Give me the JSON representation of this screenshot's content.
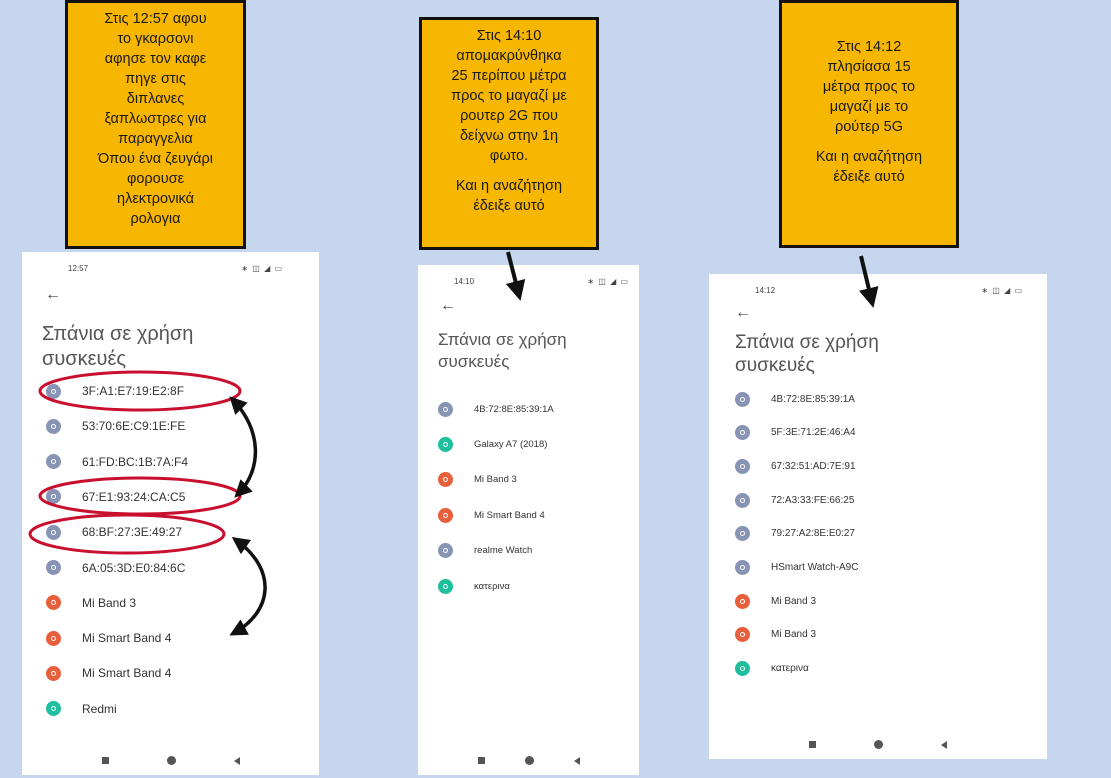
{
  "notes": [
    {
      "lines": [
        "Στις 12:57 αφου",
        "το γκαρσονι",
        "αφησε τον καφε",
        "πηγε στις",
        "διπλανες",
        "ξαπλωστρες για",
        "παραγγελια",
        "Όπου ένα ζευγάρι",
        "φορουσε",
        "ηλεκτρονικά",
        "ρολογια"
      ]
    },
    {
      "lines": [
        "Στις 14:10",
        "απομακρύνθηκα",
        "25 περίπου μέτρα",
        "προς το μαγαζί με",
        "ρουτερ 2G που",
        "δείχνω στην 1η",
        "φωτο.",
        "",
        "Και η αναζήτηση",
        "έδειξε αυτό"
      ]
    },
    {
      "lines": [
        "Στις 14:12",
        "πλησίασα 15",
        "μέτρα προς το",
        "μαγαζί με το",
        "ρούτερ 5G",
        "",
        "Και η αναζήτηση",
        "έδειξε αυτό"
      ]
    }
  ],
  "screens": [
    {
      "time": "12:57",
      "status_icons": "∗ ◫ ◢ ▭",
      "back": "←",
      "title_line1": "Σπάνια σε χρήση",
      "title_line2": "συσκευές",
      "devices": [
        {
          "name": "3F:A1:E7:19:E2:8F",
          "color": "gray"
        },
        {
          "name": "53:70:6E:C9:1E:FE",
          "color": "gray"
        },
        {
          "name": "61:FD:BC:1B:7A:F4",
          "color": "gray"
        },
        {
          "name": "67:E1:93:24:CA:C5",
          "color": "gray"
        },
        {
          "name": "68:BF:27:3E:49:27",
          "color": "gray"
        },
        {
          "name": "6A:05:3D:E0:84:6C",
          "color": "gray"
        },
        {
          "name": "Mi Band 3",
          "color": "orange"
        },
        {
          "name": "Mi Smart Band 4",
          "color": "orange"
        },
        {
          "name": "Mi Smart Band 4",
          "color": "orange"
        },
        {
          "name": "Redmi",
          "color": "teal"
        }
      ]
    },
    {
      "time": "14:10",
      "status_icons": "∗ ◫ ◢ ▭",
      "back": "←",
      "title_line1": "Σπάνια σε χρήση",
      "title_line2": "συσκευές",
      "devices": [
        {
          "name": "4B:72:8E:85:39:1A",
          "color": "gray"
        },
        {
          "name": "Galaxy A7 (2018)",
          "color": "teal"
        },
        {
          "name": "Mi Band 3",
          "color": "orange"
        },
        {
          "name": "Mi Smart Band 4",
          "color": "orange"
        },
        {
          "name": "realme Watch",
          "color": "gray"
        },
        {
          "name": "κατερινα",
          "color": "teal"
        }
      ]
    },
    {
      "time": "14:12",
      "status_icons": "∗ ◫ ◢ ▭",
      "back": "←",
      "title_line1": "Σπάνια σε χρήση",
      "title_line2": "συσκευές",
      "devices": [
        {
          "name": "4B:72:8E:85:39:1A",
          "color": "gray"
        },
        {
          "name": "5F:3E:71:2E:46:A4",
          "color": "gray"
        },
        {
          "name": "67:32:51:AD:7E:91",
          "color": "gray"
        },
        {
          "name": "72:A3:33:FE:66:25",
          "color": "gray"
        },
        {
          "name": "79:27:A2:8E:E0:27",
          "color": "gray"
        },
        {
          "name": "HSmart Watch-A9C",
          "color": "gray"
        },
        {
          "name": "Mi Band 3",
          "color": "orange"
        },
        {
          "name": "Mi Band 3",
          "color": "orange"
        },
        {
          "name": "κατερινα",
          "color": "teal"
        }
      ]
    }
  ],
  "colors": {
    "background": "#c5d6ee",
    "note": "#f7b600",
    "device_gray": "#8894b4",
    "device_orange": "#e85f3c",
    "device_teal": "#1fbf9e",
    "circle_annotation": "#c8102e"
  },
  "icons": [
    "back-arrow-icon",
    "device-icon",
    "nav-square-icon",
    "nav-home-icon",
    "nav-back-icon"
  ]
}
